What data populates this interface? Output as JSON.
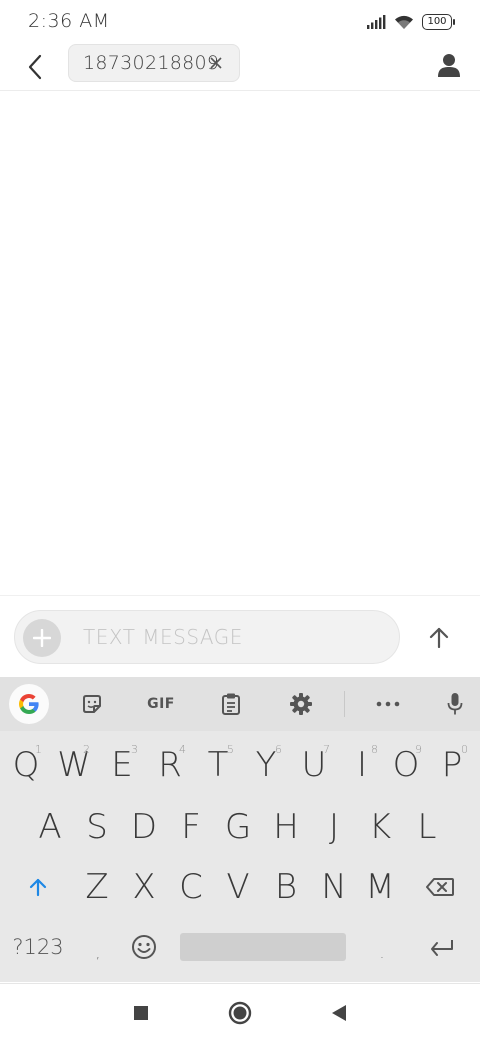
{
  "status_bar": {
    "time": "2:36 AM",
    "battery": "100",
    "icons": [
      "signal-icon",
      "wifi-icon",
      "battery-icon"
    ]
  },
  "header": {
    "back_icon": "back-arrow-icon",
    "recipient": "18730218809",
    "remove_icon": "close-icon",
    "contact_icon": "person-icon"
  },
  "compose": {
    "attach_icon": "plus-icon",
    "placeholder": "TEXT MESSAGE",
    "send_icon": "arrow-up-icon"
  },
  "keyboard": {
    "toolbar": {
      "google_icon": "google-icon",
      "sticker_icon": "sticker-icon",
      "gif_label": "GIF",
      "clipboard_icon": "clipboard-icon",
      "settings_icon": "gear-icon",
      "more_icon": "more-icon",
      "mic_icon": "mic-icon"
    },
    "row1": [
      {
        "label": "Q",
        "hint": "1"
      },
      {
        "label": "W",
        "hint": "2"
      },
      {
        "label": "E",
        "hint": "3"
      },
      {
        "label": "R",
        "hint": "4"
      },
      {
        "label": "T",
        "hint": "5"
      },
      {
        "label": "Y",
        "hint": "6"
      },
      {
        "label": "U",
        "hint": "7"
      },
      {
        "label": "I",
        "hint": "8"
      },
      {
        "label": "O",
        "hint": "9"
      },
      {
        "label": "P",
        "hint": "0"
      }
    ],
    "row2": [
      "A",
      "S",
      "D",
      "F",
      "G",
      "H",
      "J",
      "K",
      "L"
    ],
    "row3": [
      "Z",
      "X",
      "C",
      "V",
      "B",
      "N",
      "M"
    ],
    "shift_icon": "shift-icon",
    "backspace_icon": "backspace-icon",
    "symbols_label": "?123",
    "comma_label": ",",
    "emoji_icon": "emoji-icon",
    "period_label": ".",
    "enter_icon": "enter-icon"
  },
  "nav": {
    "recents_icon": "recents-square-icon",
    "home_icon": "home-circle-icon",
    "back_icon": "back-triangle-icon"
  },
  "colors": {
    "accent": "#1e88e5",
    "keyboard_bg": "#e8e8e8",
    "toolbar_bg": "#e1e1e1"
  }
}
